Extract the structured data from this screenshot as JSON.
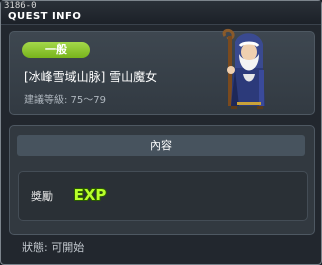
{
  "window": {
    "quest_id": "3186-0",
    "title": "QUEST INFO"
  },
  "quest": {
    "category": "一般",
    "name": "[冰峰雪域山脉] 雪山魔女",
    "level_range": "建議等級: 75～79"
  },
  "content": {
    "header": "內容",
    "reward_label": "獎勵",
    "reward_item": "EXP"
  },
  "status": "狀態: 可開始",
  "colors": {
    "badge_green": "#8cc63f",
    "exp_text": "#b8ff2a"
  },
  "npc_icon": "old-wizard-npc-portrait"
}
